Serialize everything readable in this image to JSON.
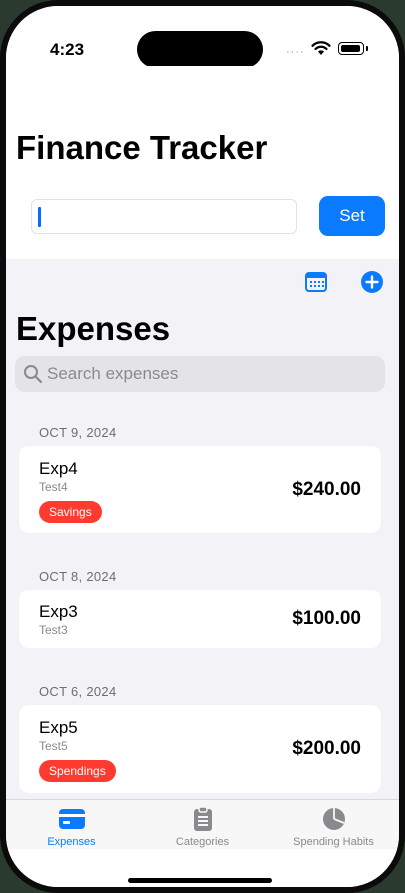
{
  "status_bar": {
    "time": "4:23",
    "signal": "····"
  },
  "header": {
    "title": "Finance Tracker",
    "budget_input": {
      "value": "",
      "placeholder": ""
    },
    "set_label": "Set"
  },
  "toolbar": {
    "calendar_icon": "calendar-icon",
    "add_icon": "plus-circle-icon"
  },
  "expenses": {
    "title": "Expenses",
    "search_placeholder": "Search expenses",
    "groups": [
      {
        "date": "OCT 9, 2024",
        "items": [
          {
            "name": "Exp4",
            "note": "Test4",
            "category": "Savings",
            "amount": "$240.00"
          }
        ]
      },
      {
        "date": "OCT 8, 2024",
        "items": [
          {
            "name": "Exp3",
            "note": "Test3",
            "category": "",
            "amount": "$100.00"
          }
        ]
      },
      {
        "date": "OCT 6, 2024",
        "items": [
          {
            "name": "Exp5",
            "note": "Test5",
            "category": "Spendings",
            "amount": "$200.00"
          }
        ]
      }
    ]
  },
  "tabbar": {
    "tabs": [
      {
        "label": "Expenses",
        "icon": "credit-card-icon",
        "active": true
      },
      {
        "label": "Categories",
        "icon": "clipboard-icon",
        "active": false
      },
      {
        "label": "Spending Habits",
        "icon": "pie-chart-icon",
        "active": false
      }
    ]
  },
  "colors": {
    "accent": "#0a7aff",
    "badge": "#ff3b30",
    "background": "#f2f2f7"
  }
}
